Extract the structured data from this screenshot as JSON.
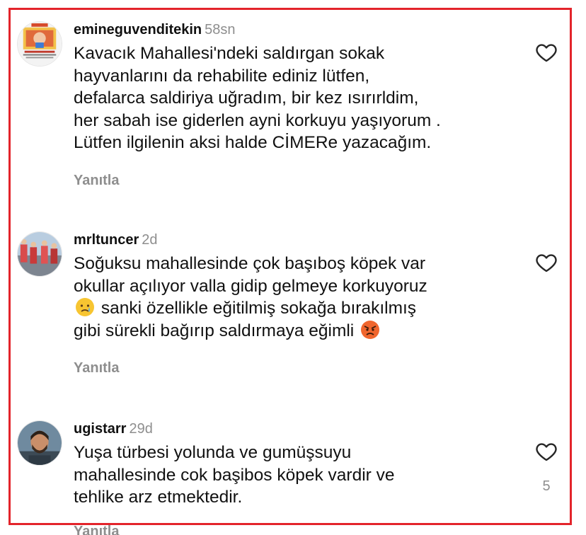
{
  "comments": [
    {
      "username": "emineguvenditekin",
      "time": "58sn",
      "lines": [
        "Kavacık Mahallesi'ndeki saldırgan sokak",
        "hayvanlarını da rehabilite ediniz lütfen,",
        "defalarca saldiriya uğradım, bir kez ısırırldim,",
        "her sabah ise giderlen ayni korkuyu yaşıyorum .",
        "Lütfen ilgilenin aksi halde CİMERe yazacağım."
      ],
      "reply_label": "Yanıtla"
    },
    {
      "username": "mrltuncer",
      "time": "2d",
      "lines": [
        "Soğuksu mahallesinde çok başıboş köpek var",
        "okullar açılıyor valla gidip gelmeye korkuyoruz",
        "sanki özellikle eğitilmiş sokağa bırakılmış",
        "gibi sürekli bağırıp saldırmaya eğimli"
      ],
      "emoji_names": [
        "crying-face-emoji",
        "angry-face-emoji"
      ],
      "reply_label": "Yanıtla"
    },
    {
      "username": "ugistarr",
      "time": "29d",
      "lines": [
        "Yuşa türbesi yolunda ve gumüşsuyu",
        "mahallesinde cok başibos köpek vardir ve",
        "tehlike arz etmektedir."
      ],
      "like_count": "5",
      "reply_label": "Yanıtla"
    }
  ],
  "colors": {
    "frame": "#e3242b",
    "secondary_text": "#8e8e8e",
    "primary_text": "#111111"
  },
  "icons": {
    "like": "heart-outline-icon"
  }
}
